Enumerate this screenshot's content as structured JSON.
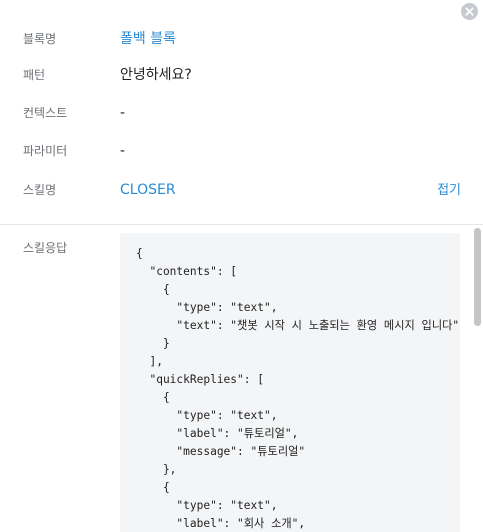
{
  "close_icon": "close-icon",
  "fields": [
    {
      "key": "block_name",
      "label": "블록명",
      "value": "폴백 블록"
    },
    {
      "key": "pattern",
      "label": "패턴",
      "value": "안녕하세요?"
    },
    {
      "key": "context",
      "label": "컨텍스트",
      "value": "-"
    },
    {
      "key": "parameter",
      "label": "파라미터",
      "value": "-"
    },
    {
      "key": "skill_name",
      "label": "스킬명",
      "value": "CLOSER",
      "action": "접기"
    }
  ],
  "skill_response": {
    "label": "스킬응답",
    "code": "{\n  \"contents\": [\n    {\n      \"type\": \"text\",\n      \"text\": \"챗봇 시작 시 노출되는 환영 메시지 입니다\"\n    }\n  ],\n  \"quickReplies\": [\n    {\n      \"type\": \"text\",\n      \"label\": \"튜토리얼\",\n      \"message\": \"튜토리얼\"\n    },\n    {\n      \"type\": \"text\",\n      \"label\": \"회사 소개\","
  },
  "colors": {
    "link": "#2a8bd5",
    "label": "#6b6f75",
    "code_bg": "#f4f5f7",
    "close_bg": "#c6c9cf"
  }
}
